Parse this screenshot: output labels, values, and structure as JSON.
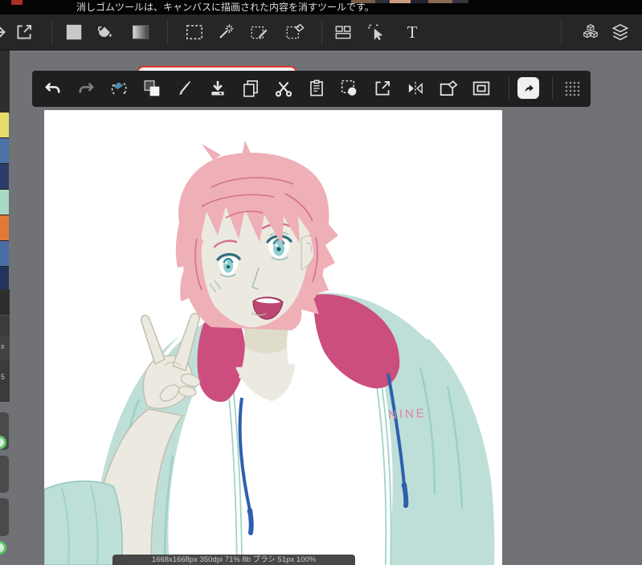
{
  "tooltip": {
    "text": "消しゴムツールは、キャンバスに描画された内容を消すツールです。"
  },
  "main_toolbar": {
    "icons": [
      "arrow-right",
      "export",
      "fill-square",
      "paint-bucket",
      "gradient",
      "rect-select",
      "magic-wand",
      "pen-select",
      "eraser-deselect",
      "panel-layout",
      "cursor-select",
      "text-tool",
      "3d-cubes",
      "layers"
    ],
    "text_tool_label": "T"
  },
  "floating_toolbar": {
    "icons": [
      "undo",
      "redo",
      "transform-eraser",
      "swap-colors",
      "pen",
      "import",
      "copy",
      "cut",
      "paste",
      "select-crop",
      "export",
      "flip-horizontal",
      "clear",
      "picture-in-picture",
      "share",
      "drag-dots"
    ]
  },
  "palette": {
    "swatches": [
      "#e6dc6a",
      "#4c72a6",
      "#2b3d6a",
      "#a9d9c6",
      "#e07a35",
      "#4a6ea4",
      "#223459"
    ],
    "swatch_styles": [
      "background:#e6dc6a",
      "background:#4c72a6",
      "background:#2b3d6a",
      "background:#a9d9c6",
      "background:#e07a35",
      "background:#4a6ea4",
      "background:#223459"
    ]
  },
  "side_panel": {
    "label_x": "x",
    "label_5": "5"
  },
  "canvas": {
    "logo_text": "NINE",
    "colors": {
      "hair_pink": "#eeafb7",
      "hair_line": "#d5708f",
      "skin": "#ebe9e0",
      "jacket_mint": "#bedfd8",
      "collar_magenta": "#cb4e7e",
      "drawstring_blue": "#2e5fae",
      "eye_teal": "#8fd0d2",
      "mouth": "#bf4672",
      "logo_pink": "#e083a5"
    }
  },
  "status_bar": {
    "text": "1668x1668px 350dpi 71% 8b ブラシ 51px 100%"
  },
  "ui_colors": {
    "workspace_bg": "#707276",
    "toolbar_bg": "#262626",
    "floating_toolbar_bg": "#1f1f1f",
    "tooltip_bg": "#040404",
    "alert_red": "#e0352b"
  }
}
